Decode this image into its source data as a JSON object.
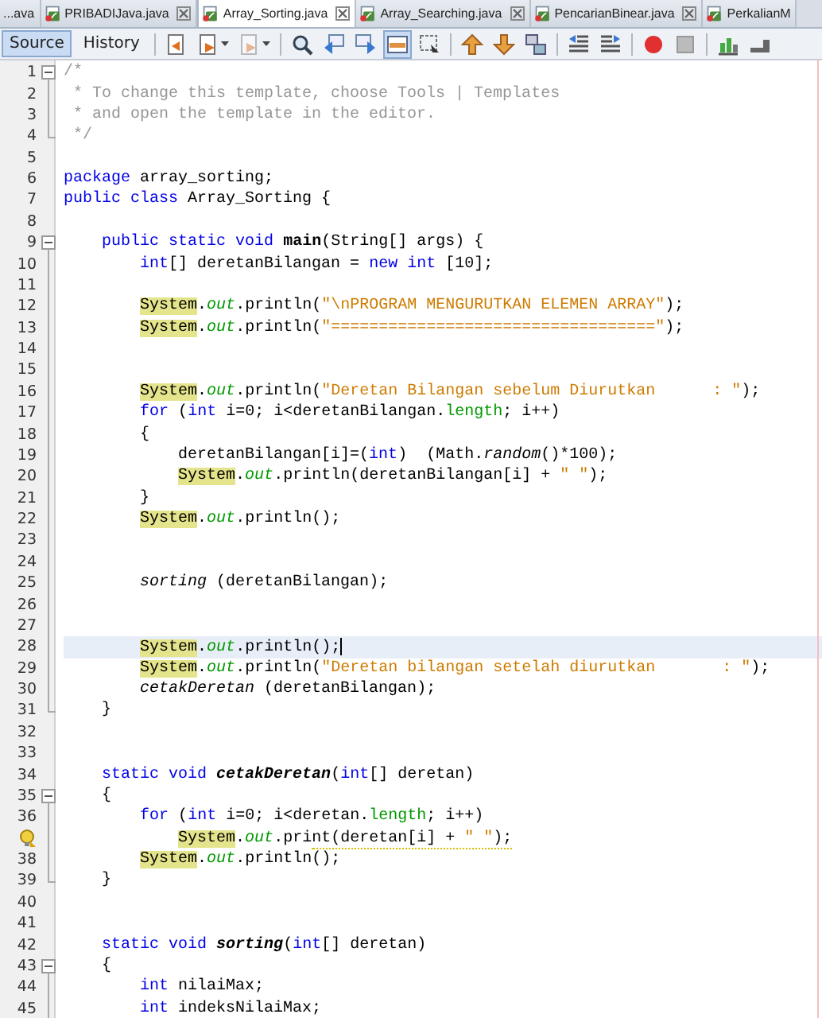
{
  "tabs": [
    {
      "label": "...ava",
      "selected": false,
      "closable": false,
      "file_icon": false
    },
    {
      "label": "PRIBADIJava.java",
      "selected": false,
      "closable": true,
      "file_icon": true
    },
    {
      "label": "Array_Sorting.java",
      "selected": true,
      "closable": true,
      "file_icon": true
    },
    {
      "label": "Array_Searching.java",
      "selected": false,
      "closable": true,
      "file_icon": true
    },
    {
      "label": "PencarianBinear.java",
      "selected": false,
      "closable": true,
      "file_icon": true
    },
    {
      "label": "PerkalianM",
      "selected": false,
      "closable": false,
      "file_icon": true
    }
  ],
  "view_buttons": [
    {
      "label": "Source",
      "selected": true
    },
    {
      "label": "History",
      "selected": false
    }
  ],
  "toolbar": {
    "highlight_toggle_on": true
  },
  "lines": [
    {
      "number": "1",
      "fold": {
        "kind": "open"
      },
      "tokens": [
        {
          "kind": "comment",
          "text": "/*"
        }
      ]
    },
    {
      "number": "2",
      "fold": {
        "kind": "mid"
      },
      "tokens": [
        {
          "kind": "comment",
          "text": " * To change this template, choose Tools | Templates"
        }
      ]
    },
    {
      "number": "3",
      "fold": {
        "kind": "mid"
      },
      "tokens": [
        {
          "kind": "comment",
          "text": " * and open the template in the editor."
        }
      ]
    },
    {
      "number": "4",
      "fold": {
        "kind": "end"
      },
      "tokens": [
        {
          "kind": "comment",
          "text": " */"
        }
      ]
    },
    {
      "number": "5"
    },
    {
      "number": "6",
      "tokens": [
        {
          "kind": "keyword",
          "text": "package"
        },
        {
          "kind": "plain",
          "text": " array_sorting;"
        }
      ]
    },
    {
      "number": "7",
      "tokens": [
        {
          "kind": "keyword",
          "text": "public class"
        },
        {
          "kind": "plain",
          "text": " Array_Sorting {"
        }
      ]
    },
    {
      "number": "8"
    },
    {
      "number": "9",
      "fold": {
        "kind": "open"
      },
      "tokens": [
        {
          "kind": "keyword",
          "text": "    public static void"
        },
        {
          "kind": "decl",
          "text": " main"
        },
        {
          "kind": "plain",
          "text": "(String[] args) {"
        }
      ]
    },
    {
      "number": "10",
      "fold": {
        "kind": "mid"
      },
      "tokens": [
        {
          "kind": "keyword",
          "text": "        int"
        },
        {
          "kind": "plain",
          "text": "[] deretanBilangan = "
        },
        {
          "kind": "keyword",
          "text": "new int"
        },
        {
          "kind": "plain",
          "text": " [10];"
        }
      ]
    },
    {
      "number": "11",
      "fold": {
        "kind": "mid"
      }
    },
    {
      "number": "12",
      "fold": {
        "kind": "mid"
      },
      "tokens": [
        {
          "kind": "system",
          "text": "        System"
        },
        {
          "kind": "plain",
          "text": "."
        },
        {
          "kind": "field",
          "text": "out"
        },
        {
          "kind": "plain",
          "text": ".println("
        },
        {
          "kind": "string",
          "text": "\"\\nPROGRAM MENGURUTKAN ELEMEN ARRAY\""
        },
        {
          "kind": "plain",
          "text": ");"
        }
      ]
    },
    {
      "number": "13",
      "fold": {
        "kind": "mid"
      },
      "tokens": [
        {
          "kind": "system",
          "text": "        System"
        },
        {
          "kind": "plain",
          "text": "."
        },
        {
          "kind": "field",
          "text": "out"
        },
        {
          "kind": "plain",
          "text": ".println("
        },
        {
          "kind": "string",
          "text": "\"==================================\""
        },
        {
          "kind": "plain",
          "text": ");"
        }
      ]
    },
    {
      "number": "14",
      "fold": {
        "kind": "mid"
      }
    },
    {
      "number": "15",
      "fold": {
        "kind": "mid"
      }
    },
    {
      "number": "16",
      "fold": {
        "kind": "mid"
      },
      "tokens": [
        {
          "kind": "system",
          "text": "        System"
        },
        {
          "kind": "plain",
          "text": "."
        },
        {
          "kind": "field",
          "text": "out"
        },
        {
          "kind": "plain",
          "text": ".println("
        },
        {
          "kind": "string",
          "text": "\"Deretan Bilangan sebelum Diurutkan      : \""
        },
        {
          "kind": "plain",
          "text": ");"
        }
      ]
    },
    {
      "number": "17",
      "fold": {
        "kind": "mid"
      },
      "tokens": [
        {
          "kind": "keyword",
          "text": "        for"
        },
        {
          "kind": "plain",
          "text": " ("
        },
        {
          "kind": "keyword",
          "text": "int"
        },
        {
          "kind": "plain",
          "text": " i=0; i<deretanBilangan."
        },
        {
          "kind": "member",
          "text": "length"
        },
        {
          "kind": "plain",
          "text": "; i++)"
        }
      ]
    },
    {
      "number": "18",
      "fold": {
        "kind": "mid"
      },
      "tokens": [
        {
          "kind": "plain",
          "text": "        {"
        }
      ]
    },
    {
      "number": "19",
      "fold": {
        "kind": "mid"
      },
      "tokens": [
        {
          "kind": "plain",
          "text": "            deretanBilangan[i]=("
        },
        {
          "kind": "keyword",
          "text": "int"
        },
        {
          "kind": "plain",
          "text": ")  (Math."
        },
        {
          "kind": "call",
          "text": "random"
        },
        {
          "kind": "plain",
          "text": "()*100);"
        }
      ]
    },
    {
      "number": "20",
      "fold": {
        "kind": "mid"
      },
      "tokens": [
        {
          "kind": "system",
          "text": "            System"
        },
        {
          "kind": "plain",
          "text": "."
        },
        {
          "kind": "field",
          "text": "out"
        },
        {
          "kind": "plain",
          "text": ".println(deretanBilangan[i] + "
        },
        {
          "kind": "string",
          "text": "\" \""
        },
        {
          "kind": "plain",
          "text": ");"
        }
      ]
    },
    {
      "number": "21",
      "fold": {
        "kind": "mid"
      },
      "tokens": [
        {
          "kind": "plain",
          "text": "        }"
        }
      ]
    },
    {
      "number": "22",
      "fold": {
        "kind": "mid"
      },
      "tokens": [
        {
          "kind": "system",
          "text": "        System"
        },
        {
          "kind": "plain",
          "text": "."
        },
        {
          "kind": "field",
          "text": "out"
        },
        {
          "kind": "plain",
          "text": ".println();"
        }
      ]
    },
    {
      "number": "23",
      "fold": {
        "kind": "mid"
      }
    },
    {
      "number": "24",
      "fold": {
        "kind": "mid"
      }
    },
    {
      "number": "25",
      "fold": {
        "kind": "mid"
      },
      "tokens": [
        {
          "kind": "call",
          "text": "        sorting"
        },
        {
          "kind": "plain",
          "text": " (deretanBilangan);"
        }
      ]
    },
    {
      "number": "26",
      "fold": {
        "kind": "mid"
      }
    },
    {
      "number": "27",
      "fold": {
        "kind": "mid"
      }
    },
    {
      "number": "28",
      "fold": {
        "kind": "mid"
      },
      "current": true,
      "tokens": [
        {
          "kind": "system",
          "text": "        System"
        },
        {
          "kind": "plain",
          "text": "."
        },
        {
          "kind": "field",
          "text": "out"
        },
        {
          "kind": "plain",
          "text": ".println();"
        }
      ]
    },
    {
      "number": "29",
      "fold": {
        "kind": "mid"
      },
      "tokens": [
        {
          "kind": "system",
          "text": "        System"
        },
        {
          "kind": "plain",
          "text": "."
        },
        {
          "kind": "field",
          "text": "out"
        },
        {
          "kind": "plain",
          "text": ".println("
        },
        {
          "kind": "string",
          "text": "\"Deretan bilangan setelah diurutkan       : \""
        },
        {
          "kind": "plain",
          "text": ");"
        }
      ]
    },
    {
      "number": "30",
      "fold": {
        "kind": "mid"
      },
      "tokens": [
        {
          "kind": "call",
          "text": "        cetakDeretan"
        },
        {
          "kind": "plain",
          "text": " (deretanBilangan);"
        }
      ]
    },
    {
      "number": "31",
      "fold": {
        "kind": "end"
      },
      "tokens": [
        {
          "kind": "plain",
          "text": "    }"
        }
      ]
    },
    {
      "number": "32"
    },
    {
      "number": "33"
    },
    {
      "number": "34",
      "tokens": [
        {
          "kind": "keyword",
          "text": "    static void"
        },
        {
          "kind": "decl-static",
          "text": " cetakDeretan"
        },
        {
          "kind": "plain",
          "text": "("
        },
        {
          "kind": "keyword",
          "text": "int"
        },
        {
          "kind": "plain",
          "text": "[] deretan)"
        }
      ]
    },
    {
      "number": "35",
      "fold": {
        "kind": "open"
      },
      "tokens": [
        {
          "kind": "plain",
          "text": "    {"
        }
      ]
    },
    {
      "number": "36",
      "fold": {
        "kind": "mid"
      },
      "tokens": [
        {
          "kind": "keyword",
          "text": "        for"
        },
        {
          "kind": "plain",
          "text": " ("
        },
        {
          "kind": "keyword",
          "text": "int"
        },
        {
          "kind": "plain",
          "text": " i=0; i<deretan."
        },
        {
          "kind": "member",
          "text": "length"
        },
        {
          "kind": "plain",
          "text": "; i++)"
        }
      ]
    },
    {
      "fold": {
        "kind": "mid"
      },
      "hint": true,
      "tokens": [
        {
          "kind": "system",
          "text": "            System"
        },
        {
          "kind": "plain",
          "text": "."
        },
        {
          "kind": "field",
          "text": "out"
        },
        {
          "kind": "plain",
          "text": ".print(deretan[i] + "
        },
        {
          "kind": "string",
          "text": "\" \""
        },
        {
          "kind": "plain",
          "text": ");"
        }
      ]
    },
    {
      "number": "38",
      "fold": {
        "kind": "mid"
      },
      "tokens": [
        {
          "kind": "system",
          "text": "        System"
        },
        {
          "kind": "plain",
          "text": "."
        },
        {
          "kind": "field",
          "text": "out"
        },
        {
          "kind": "plain",
          "text": ".println();"
        }
      ]
    },
    {
      "number": "39",
      "fold": {
        "kind": "end"
      },
      "tokens": [
        {
          "kind": "plain",
          "text": "    }"
        }
      ]
    },
    {
      "number": "40"
    },
    {
      "number": "41"
    },
    {
      "number": "42",
      "tokens": [
        {
          "kind": "keyword",
          "text": "    static void"
        },
        {
          "kind": "decl-static",
          "text": " sorting"
        },
        {
          "kind": "plain",
          "text": "("
        },
        {
          "kind": "keyword",
          "text": "int"
        },
        {
          "kind": "plain",
          "text": "[] deretan)"
        }
      ]
    },
    {
      "number": "43",
      "fold": {
        "kind": "open"
      },
      "tokens": [
        {
          "kind": "plain",
          "text": "    {"
        }
      ]
    },
    {
      "number": "44",
      "fold": {
        "kind": "mid"
      },
      "tokens": [
        {
          "kind": "keyword",
          "text": "        int"
        },
        {
          "kind": "plain",
          "text": " nilaiMax;"
        }
      ]
    },
    {
      "number": "45",
      "fold": {
        "kind": "mid"
      },
      "tokens": [
        {
          "kind": "keyword",
          "text": "        int"
        },
        {
          "kind": "plain",
          "text": " indeksNilaiMax;"
        }
      ]
    }
  ]
}
